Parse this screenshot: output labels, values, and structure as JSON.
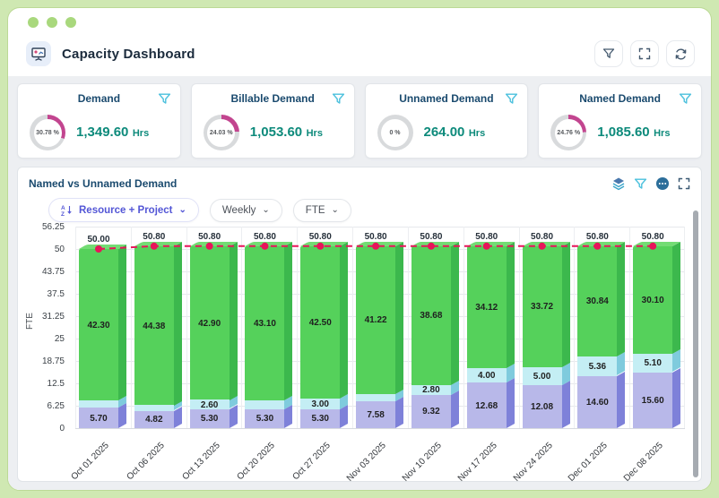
{
  "window_controls": {
    "dots": 3
  },
  "header": {
    "title": "Capacity Dashboard",
    "actions": [
      "filter",
      "fullscreen",
      "refresh"
    ]
  },
  "kpi_cards": [
    {
      "title": "Demand",
      "percent_label": "30.78 %",
      "percent": 30.78,
      "value": "1,349.60",
      "unit": "Hrs"
    },
    {
      "title": "Billable Demand",
      "percent_label": "24.03 %",
      "percent": 24.03,
      "value": "1,053.60",
      "unit": "Hrs"
    },
    {
      "title": "Unnamed Demand",
      "percent_label": "0 %",
      "percent": 0,
      "value": "264.00",
      "unit": "Hrs"
    },
    {
      "title": "Named Demand",
      "percent_label": "24.76 %",
      "percent": 24.76,
      "value": "1,085.60",
      "unit": "Hrs"
    }
  ],
  "kpi_style": {
    "arc_color": "#c2458f",
    "ring_color": "#d8dadc",
    "value_color": "#0d8a7b"
  },
  "chart_section": {
    "title": "Named vs Unnamed Demand",
    "controls": {
      "sort_label": "Resource + Project",
      "period_label": "Weekly",
      "metric_label": "FTE"
    },
    "icons": [
      "layers",
      "filter",
      "more",
      "fullscreen"
    ]
  },
  "chart_data": {
    "type": "bar",
    "stacked": true,
    "ylabel": "FTE",
    "ylim": [
      0,
      56.25
    ],
    "yticks": [
      0,
      6.25,
      12.5,
      18.75,
      25,
      31.25,
      37.5,
      43.75,
      50,
      56.25
    ],
    "grid": true,
    "categories": [
      "Oct 01 2025",
      "Oct 06 2025",
      "Oct 13 2025",
      "Oct 20 2025",
      "Oct 27 2025",
      "Nov 03 2025",
      "Nov 10 2025",
      "Nov 17 2025",
      "Nov 24 2025",
      "Dec 01 2025",
      "Dec 08 2025"
    ],
    "series": [
      {
        "name": "bottom",
        "color": "#b8b8e9",
        "side_color": "#7e81d9",
        "values": [
          5.7,
          4.82,
          5.3,
          5.3,
          5.3,
          7.58,
          9.32,
          12.68,
          12.08,
          14.6,
          15.6
        ],
        "labels": [
          "5.70",
          "4.82",
          "5.30",
          "5.30",
          "5.30",
          "7.58",
          "9.32",
          "12.68",
          "12.08",
          "14.60",
          "15.60"
        ]
      },
      {
        "name": "middle",
        "color": "#c4eef4",
        "side_color": "#7fcbdd",
        "values": [
          2.0,
          1.6,
          2.6,
          2.4,
          3.0,
          2.0,
          2.8,
          4.0,
          5.0,
          5.36,
          5.1
        ],
        "labels": [
          "",
          "",
          "2.60",
          "",
          "3.00",
          "",
          "2.80",
          "4.00",
          "5.00",
          "5.36",
          "5.10"
        ]
      },
      {
        "name": "top",
        "color": "#55d15b",
        "side_color": "#3cb84d",
        "top_color": "#73dc74",
        "values": [
          42.3,
          44.38,
          42.9,
          43.1,
          42.5,
          41.22,
          38.68,
          34.12,
          33.72,
          30.84,
          30.1
        ],
        "labels": [
          "42.30",
          "44.38",
          "42.90",
          "43.10",
          "42.50",
          "41.22",
          "38.68",
          "34.12",
          "33.72",
          "30.84",
          "30.10"
        ]
      }
    ],
    "line": {
      "name": "capacity",
      "color": "#e8145a",
      "values": [
        50.0,
        50.8,
        50.8,
        50.8,
        50.8,
        50.8,
        50.8,
        50.8,
        50.8,
        50.8,
        50.8
      ],
      "labels": [
        "50.00",
        "50.80",
        "50.80",
        "50.80",
        "50.80",
        "50.80",
        "50.80",
        "50.80",
        "50.80",
        "50.80",
        "50.80"
      ]
    }
  }
}
